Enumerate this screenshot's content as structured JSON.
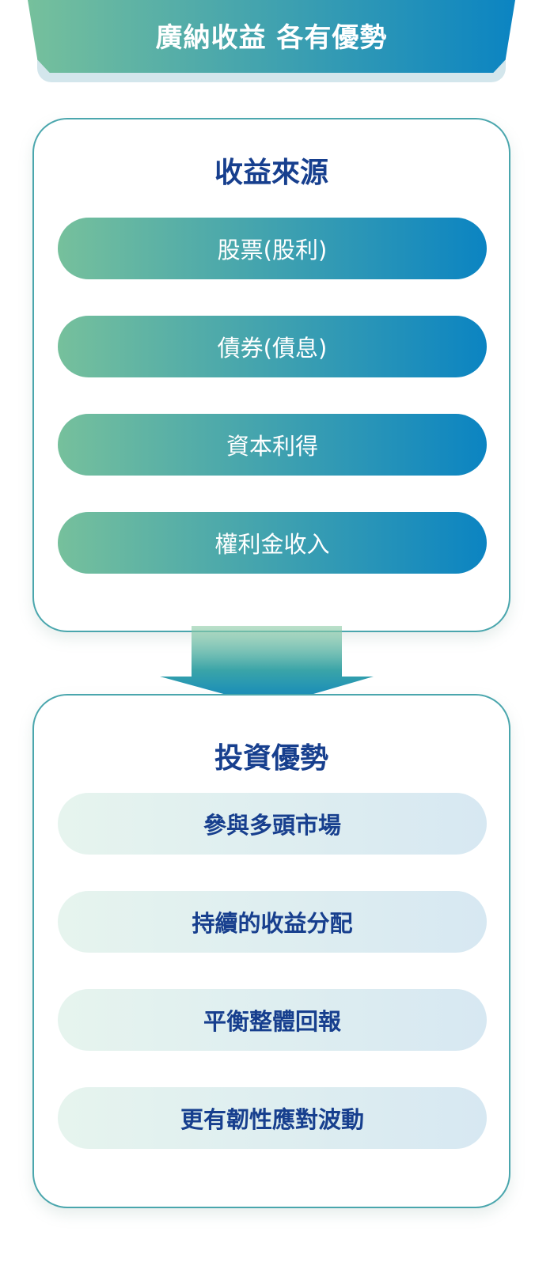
{
  "header": {
    "title": "廣納收益 各有優勢"
  },
  "income_sources": {
    "title": "收益來源",
    "items": [
      "股票(股利)",
      "債券(債息)",
      "資本利得",
      "權利金收入"
    ]
  },
  "arrow": {
    "icon": "down-arrow-icon"
  },
  "advantages": {
    "title": "投資優勢",
    "items": [
      "參與多頭市場",
      "持續的收益分配",
      "平衡整體回報",
      "更有韌性應對波動"
    ]
  },
  "colors": {
    "gradient_start": "#76c09c",
    "gradient_end": "#0b84c2",
    "title_blue": "#173f8e",
    "card_border": "#4aa6ad",
    "pale_start": "#e6f4ee",
    "pale_end": "#d7e8f2"
  }
}
